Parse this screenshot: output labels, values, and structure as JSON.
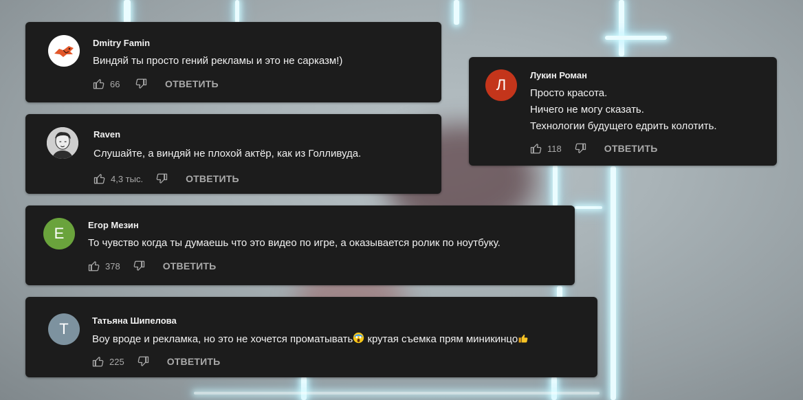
{
  "reply_label": "ОТВЕТИТЬ",
  "colors": {
    "card_bg": "#1c1c1c",
    "text": "#f1f1f1",
    "muted": "#aaaaaa",
    "avatar_lukin": "#c4351b",
    "avatar_egor": "#6aa33c",
    "avatar_tatyana": "#7d929f"
  },
  "comments": [
    {
      "author": "Dmitry Famin",
      "avatar": "fox-logo-avatar",
      "text": "Виндяй ты просто гений рекламы и это не сарказм!)",
      "likes": "66"
    },
    {
      "author": "Raven",
      "avatar": "portrait-photo-avatar",
      "text": "Слушайте, а виндяй не плохой актёр, как из Голливуда.",
      "likes": "4,3 тыс."
    },
    {
      "author": "Егор Мезин",
      "avatar_letter": "Е",
      "text": "То чувство когда ты думаешь что это видео по игре, а оказывается ролик по ноутбуку.",
      "likes": "378"
    },
    {
      "author": "Татьяна Шипелова",
      "avatar_letter": "Т",
      "text_part1": "Воу вроде и рекламка, но это не хочется проматывать",
      "emoji1": "screaming-face-emoji",
      "text_part2": " крутая съемка прям миникинцо",
      "emoji2": "thumbs-up-emoji",
      "likes": "225"
    },
    {
      "author": "Лукин Роман",
      "avatar_letter": "Л",
      "text_lines": [
        "Просто красота.",
        "Ничего не могу сказать.",
        "Технологии будущего едрить колотить."
      ],
      "likes": "118"
    }
  ]
}
